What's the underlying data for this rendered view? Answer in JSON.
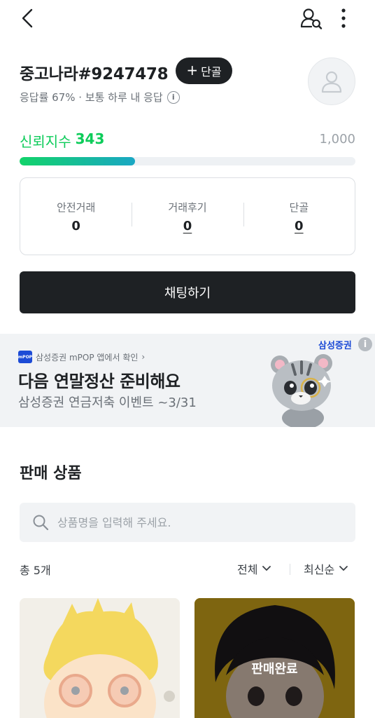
{
  "header": {
    "back_icon": "chevron-left-icon",
    "user_search_icon": "user-search-icon",
    "more_icon": "more-vertical-icon"
  },
  "profile": {
    "shop_name": "중고나라#9247478",
    "follow_label": "단골",
    "response_info": "응답률 67% · 보통 하루 내 응답",
    "info_icon_glyph": "i"
  },
  "trust": {
    "label": "신뢰지수",
    "score": "343",
    "max": "1,000",
    "score_value": 343,
    "max_value": 1000
  },
  "stats": [
    {
      "label": "안전거래",
      "value": "0"
    },
    {
      "label": "거래후기",
      "value": "0"
    },
    {
      "label": "단골",
      "value": "0"
    }
  ],
  "chat_button": "채팅하기",
  "ad": {
    "logo_text": "mPOP",
    "source": "삼성증권 mPOP 앱에서 확인",
    "source_chevron": "›",
    "headline": "다음 연말정산 준비해요",
    "sub": "삼성증권 연금저축 이벤트 ~3/31",
    "brand": "삼성증권",
    "info_glyph": "i"
  },
  "products": {
    "title": "판매 상품",
    "search_placeholder": "상품명을 입력해 주세요.",
    "count": "총 5개",
    "filter": "전체",
    "sort": "최신순",
    "sold_label": "판매완료"
  },
  "colors": {
    "accent_green": "#0dcc5a",
    "dark_button": "#1e2124",
    "ad_brand_blue": "#1c4bd6"
  }
}
